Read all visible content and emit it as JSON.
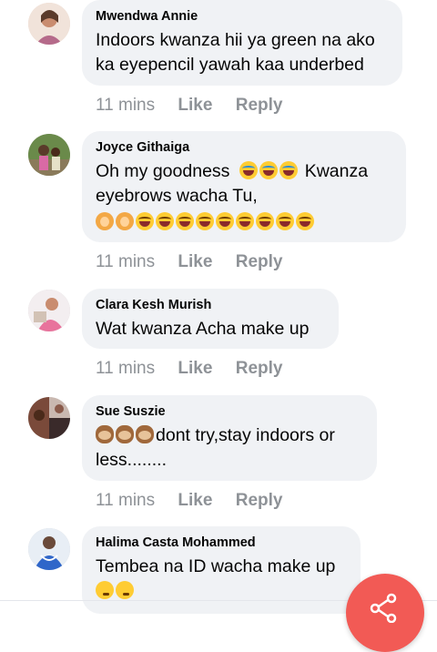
{
  "comments": [
    {
      "author": "Mwendwa Annie",
      "text": "Indoors kwanza hii ya green na ako ka eyepencil yawah kaa underbed",
      "time": "11 mins",
      "like": "Like",
      "reply": "Reply"
    },
    {
      "author": "Joyce Githaiga",
      "text_a": "Oh my goodness",
      "text_b": "Kwanza eyebrows wacha Tu,",
      "time": "11 mins",
      "like": "Like",
      "reply": "Reply"
    },
    {
      "author": "Clara Kesh Murish",
      "text": "Wat kwanza Acha make up",
      "time": "11 mins",
      "like": "Like",
      "reply": "Reply"
    },
    {
      "author": "Sue Suszie",
      "text": "dont try,stay indoors or less........",
      "time": "11 mins",
      "like": "Like",
      "reply": "Reply"
    },
    {
      "author": "Halima Casta Mohammed",
      "text": "Tembea na ID wacha make up"
    }
  ],
  "colors": {
    "bubble": "#f0f2f5",
    "meta": "#8e9297",
    "fab": "#f25a55"
  },
  "icons": {
    "fab": "share-icon"
  }
}
